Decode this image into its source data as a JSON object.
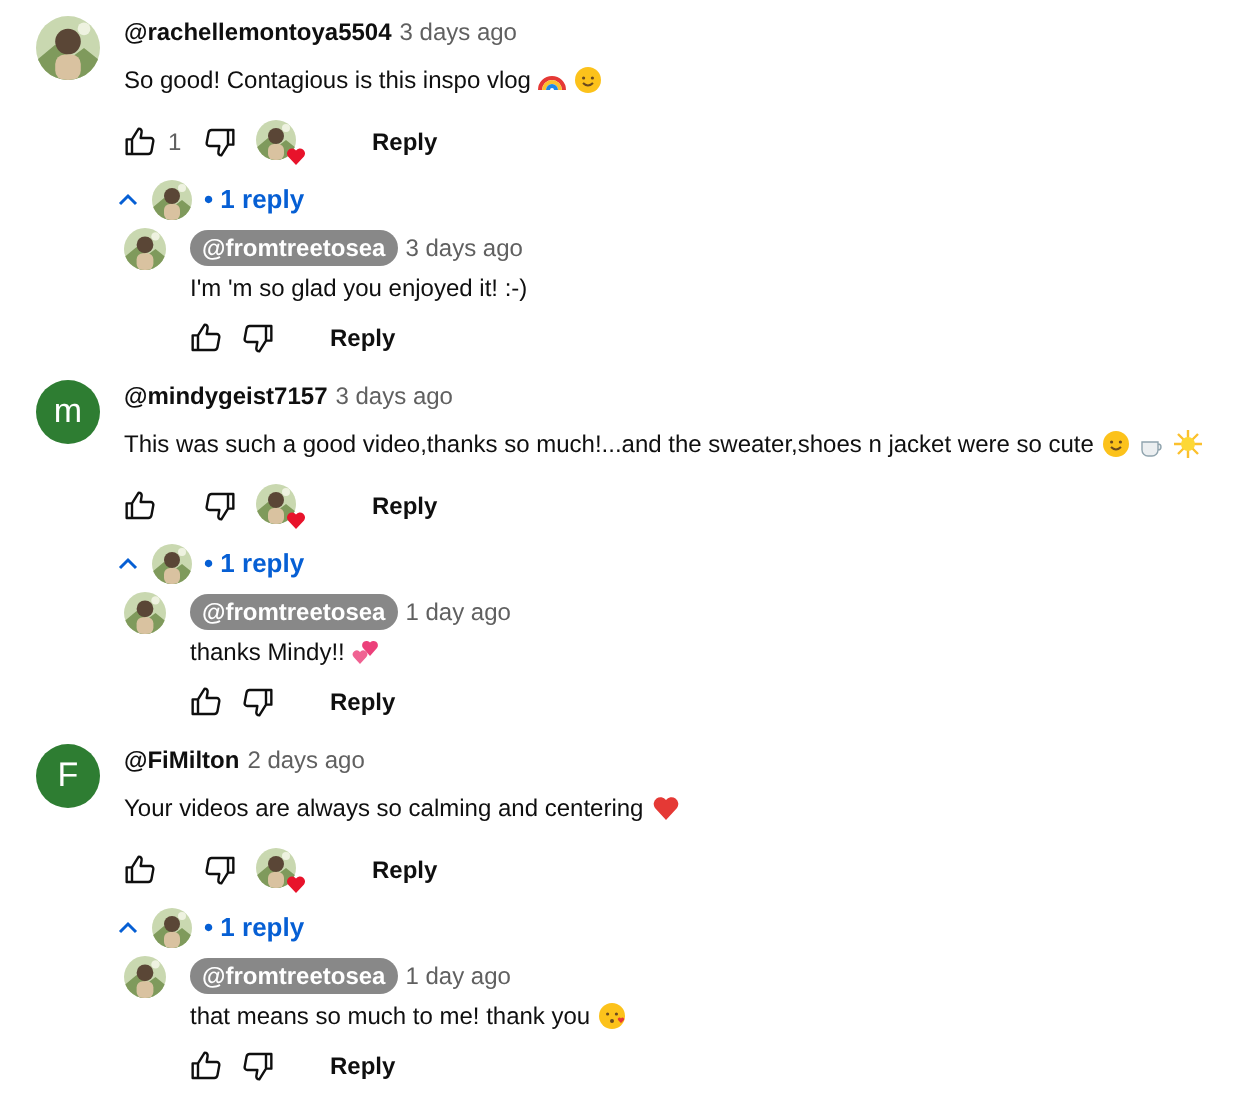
{
  "comments": [
    {
      "avatar": {
        "kind": "picture"
      },
      "author": "@rachellemontoya5504",
      "time": "3 days ago",
      "text": "So good!  Contagious is this inspo vlog",
      "emojis": [
        {
          "kind": "rainbow"
        },
        {
          "kind": "smile"
        }
      ],
      "likes": "1",
      "hearted": true,
      "reply_button": "Reply",
      "replies_toggle": {
        "expanded": true,
        "label": "• 1 reply"
      },
      "replies": [
        {
          "author": "@fromtreetosea",
          "time": "3 days ago",
          "text": "I'm 'm so glad you enjoyed it! :-)",
          "reply_button": "Reply"
        }
      ]
    },
    {
      "avatar": {
        "kind": "letter",
        "letter": "m",
        "color": "#2e7d32"
      },
      "author": "@mindygeist7157",
      "time": "3 days ago",
      "text": "This was such a good video,thanks so much!...and the sweater,shoes n jacket were so cute",
      "emojis": [
        {
          "kind": "relieved"
        },
        {
          "kind": "coffee"
        },
        {
          "kind": "sun"
        }
      ],
      "hearted": true,
      "reply_button": "Reply",
      "replies_toggle": {
        "expanded": true,
        "label": "• 1 reply"
      },
      "replies": [
        {
          "author": "@fromtreetosea",
          "time": "1 day ago",
          "text": "thanks Mindy!!",
          "emojis": [
            {
              "kind": "hearts"
            }
          ],
          "reply_button": "Reply"
        }
      ]
    },
    {
      "avatar": {
        "kind": "letter",
        "letter": "F",
        "color": "#2e7d32"
      },
      "author": "@FiMilton",
      "time": "2 days ago",
      "text": "Your videos are always so calming and centering",
      "emojis": [
        {
          "kind": "heart"
        }
      ],
      "hearted": true,
      "reply_button": "Reply",
      "replies_toggle": {
        "expanded": true,
        "label": "• 1 reply"
      },
      "replies": [
        {
          "author": "@fromtreetosea",
          "time": "1 day ago",
          "text": "that means so much to me! thank you",
          "emojis": [
            {
              "kind": "kiss"
            }
          ],
          "reply_button": "Reply"
        }
      ]
    }
  ]
}
